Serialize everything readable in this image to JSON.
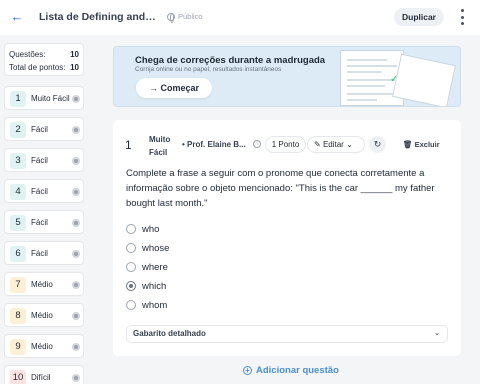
{
  "header": {
    "title": "Lista de Defining and non d...",
    "visibility": "Público",
    "duplicate_label": "Duplicar"
  },
  "summary": {
    "questions_label": "Questões:",
    "questions_value": "10",
    "points_label": "Total de pontos:",
    "points_value": "10"
  },
  "sidebar": {
    "items": [
      {
        "number": "1",
        "level": "Muito Fácil",
        "color": "#e0f2f1"
      },
      {
        "number": "2",
        "level": "Fácil",
        "color": "#e0f2f1"
      },
      {
        "number": "3",
        "level": "Fácil",
        "color": "#e0f2f1"
      },
      {
        "number": "4",
        "level": "Fácil",
        "color": "#e0f2f1"
      },
      {
        "number": "5",
        "level": "Fácil",
        "color": "#e0f2f1"
      },
      {
        "number": "6",
        "level": "Fácil",
        "color": "#e0f2f1"
      },
      {
        "number": "7",
        "level": "Médio",
        "color": "#fdf0d5"
      },
      {
        "number": "8",
        "level": "Médio",
        "color": "#fdf0d5"
      },
      {
        "number": "9",
        "level": "Médio",
        "color": "#fdf0d5"
      },
      {
        "number": "10",
        "level": "Difícil",
        "color": "#fde2e2"
      }
    ]
  },
  "banner": {
    "title": "Chega de correções durante a madrugada",
    "subtitle": "Corrija online ou no papel, resultados instantâneos",
    "button_label": "Começar"
  },
  "question": {
    "number": "1",
    "difficulty": "Muito Fácil",
    "author": "Prof. Elaine B...",
    "points": "1 Ponto",
    "edit_label": "Editar",
    "delete_label": "Excluir",
    "statement": "Complete a frase a seguir com o pronome que conecta corretamente a informação sobre o objeto mencionado: \"This is the car ______ my father bought last month.\"",
    "options": [
      {
        "text": "who",
        "selected": false
      },
      {
        "text": "whose",
        "selected": false
      },
      {
        "text": "where",
        "selected": false
      },
      {
        "text": "which",
        "selected": true
      },
      {
        "text": "whom",
        "selected": false
      }
    ],
    "answer_key_label": "Gabarito detalhado"
  },
  "footer": {
    "add_question_label": "Adicionar questão"
  }
}
